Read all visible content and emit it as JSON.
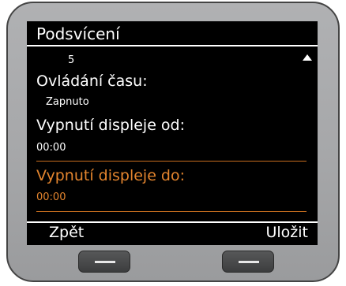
{
  "screen": {
    "title": "Podsvícení",
    "items": [
      {
        "value": "5"
      },
      {
        "label": "Ovládání času:",
        "value": "Zapnuto"
      },
      {
        "label": "Vypnutí displeje od:",
        "value": "00:00"
      },
      {
        "label": "Vypnutí displeje do:",
        "value": "00:00",
        "selected": true
      }
    ],
    "softkeys": {
      "left": "Zpět",
      "right": "Uložit"
    }
  },
  "colors": {
    "highlight": "#e4852e",
    "screen_bg": "#000000",
    "text": "#ffffff",
    "bezel": "#a8a9ab"
  },
  "icons": {
    "scroll": "scroll-up-arrow-icon"
  }
}
